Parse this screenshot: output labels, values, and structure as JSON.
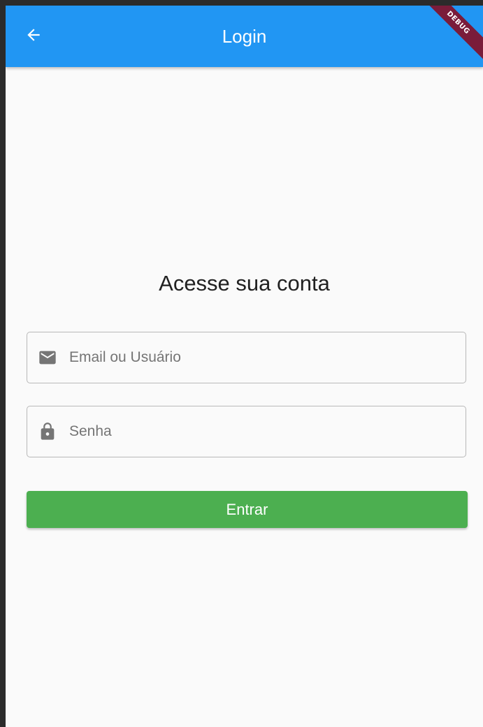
{
  "app_bar": {
    "title": "Login",
    "back_icon": "arrow-back-icon",
    "color": "#2196f3",
    "debug_banner": "DEBUG"
  },
  "login_form": {
    "heading": "Acesse sua conta",
    "email_field": {
      "placeholder": "Email ou Usuário",
      "value": "",
      "icon": "mail-icon"
    },
    "password_field": {
      "placeholder": "Senha",
      "value": "",
      "icon": "lock-icon"
    },
    "submit_button": {
      "label": "Entrar",
      "color": "#4caf50"
    }
  }
}
